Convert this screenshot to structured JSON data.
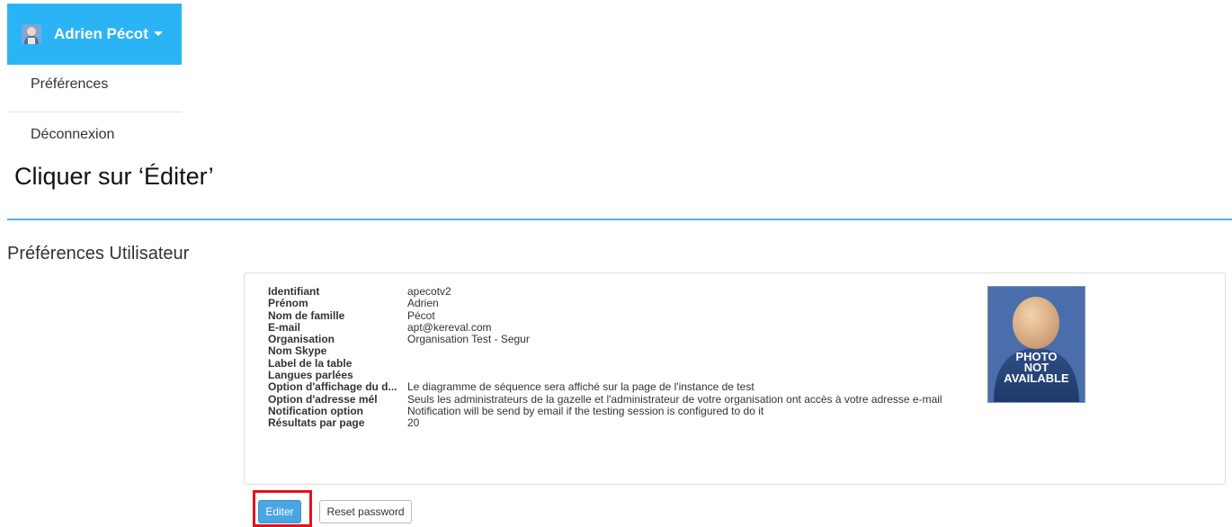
{
  "user": {
    "name": "Adrien Pécot",
    "icon": "user-avatar-icon"
  },
  "menu": {
    "preferences": "Préférences",
    "logout": "Déconnexion"
  },
  "instruction": "Cliquer sur ‘Éditer’",
  "section_title": "Préférences Utilisateur",
  "details": [
    {
      "label": "Identifiant",
      "value": "apecotv2"
    },
    {
      "label": "Prénom",
      "value": "Adrien"
    },
    {
      "label": "Nom de famille",
      "value": "Pécot"
    },
    {
      "label": "E-mail",
      "value": "apt@kereval.com"
    },
    {
      "label": "Organisation",
      "value": "Organisation Test - Segur"
    },
    {
      "label": "Nom Skype",
      "value": ""
    },
    {
      "label": "Label de la table",
      "value": ""
    },
    {
      "label": "Langues parlées",
      "value": ""
    },
    {
      "label": "Option d'affichage du d...",
      "value": "Le diagramme de séquence sera affiché sur la page de l'instance de test"
    },
    {
      "label": "Option d'adresse mél",
      "value": "Seuls les administrateurs de la gazelle et l'administrateur de votre organisation ont accès à votre adresse e-mail"
    },
    {
      "label": "Notification option",
      "value": "Notification will be send by email if the testing session is configured to do it"
    },
    {
      "label": "Résultats par page",
      "value": "20"
    }
  ],
  "photo": {
    "line1": "PHOTO",
    "line2": "NOT",
    "line3": "AVAILABLE"
  },
  "buttons": {
    "edit": "Editer",
    "reset_password": "Reset password"
  },
  "colors": {
    "header_bg": "#2ab4f5",
    "rule": "#4fb5e6",
    "edit_button": "#4aa6e2",
    "highlight": "#e3131b"
  }
}
